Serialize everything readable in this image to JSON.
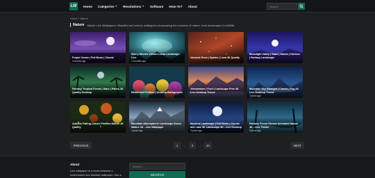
{
  "header": {
    "logo_text": "LW",
    "nav": [
      {
        "label": "Home",
        "has_dropdown": false
      },
      {
        "label": "Categories",
        "has_dropdown": true
      },
      {
        "label": "Resolutions",
        "has_dropdown": true
      },
      {
        "label": "Software",
        "has_dropdown": false
      },
      {
        "label": "How-To?",
        "has_dropdown": false
      },
      {
        "label": "About",
        "has_dropdown": false
      }
    ],
    "search_placeholder": "Search",
    "accent_color": "#0f6b52"
  },
  "breadcrumb": {
    "home": "Home",
    "separator": "/",
    "current": "Nature"
  },
  "heading": {
    "title": "Nature",
    "description": "Nature Live Wallpapers: Beautiful and serene wallpapers showcasing the wonders of nature, from landscapes to wildlife."
  },
  "cards": [
    {
      "title": "Purple Ocean | Full Moon | Clouds",
      "date": "4 months ago"
    },
    {
      "title": "Starry Shores Vibrant Lunar Landscape Live",
      "date": "10 months ago"
    },
    {
      "title": "Volcanic Rock | Sparks | Lava 4K Quality",
      "date": ""
    },
    {
      "title": "Moonlight Valley | Stars | Waves | Horizon | Fantasy Landscape",
      "date": ""
    },
    {
      "title": "Fantasy Tropical Forest | Stars | Palms 4K Quality Desktop",
      "date": ""
    },
    {
      "title": "Rainforest Fireflies | Desktop Background",
      "date": ""
    },
    {
      "title": "Yellowstone | Ford | Landscape Free 4K Live Desktop Theme",
      "date": ""
    },
    {
      "title": "Mountain Sky Starlight | Clouds | Fog 4K Live Desktop Theme",
      "date": "2 years ago"
    },
    {
      "title": "Autumn Falling Leaves Fireflies Nature 4K Quality",
      "date": ""
    },
    {
      "title": "Mountain Atmospheric Landscape Scene Nature 4K - Live Wallpaper",
      "date": "3 years ago"
    },
    {
      "title": "Mystical Landscape | Full Moon | Clouds and Lake 4K Landscape 4K - Live Desktop",
      "date": "3 years ago"
    },
    {
      "title": "Fantasy Forest Stream Animated Nature 4K - Live Theme",
      "date": "3 years ago"
    }
  ],
  "pagination": {
    "prev": "PREVIOUS",
    "next": "NEXT",
    "pages": [
      "1",
      "...",
      "3",
      "...",
      "10"
    ]
  },
  "footer": {
    "about_title": "About",
    "about_text": "Live wallpaper is a cross between a screensaver and desktop wallpaper. Like a",
    "search_placeholder": "Search ...",
    "search_button": "SEARCH"
  }
}
